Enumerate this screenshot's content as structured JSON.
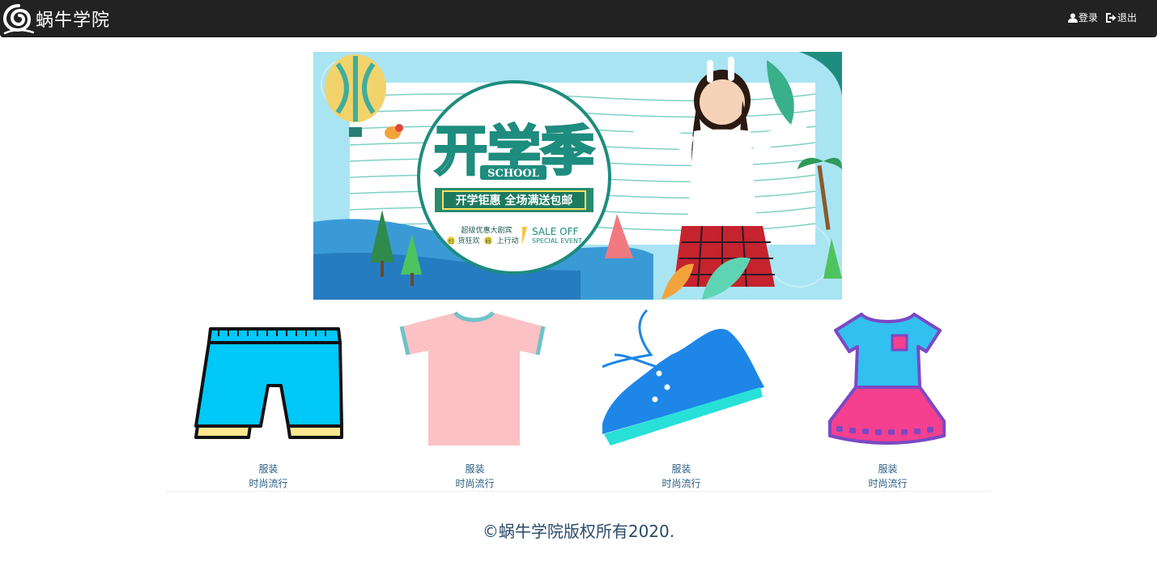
{
  "header": {
    "brand": "蜗牛学院",
    "login_label": "登录",
    "logout_label": "退出"
  },
  "banner": {
    "title": "开学季",
    "school": "SCHOOL",
    "slogan": "开学钜惠 全场满送包邮",
    "promo_line1": "超级优惠大剧宾",
    "promo_line2a": "扫",
    "promo_line2b": "货狂欢",
    "promo_line2c": "码",
    "promo_line2d": "上行动",
    "sale": "SALE OFF",
    "event": "SPECIAL EVENT"
  },
  "products": [
    {
      "name": "服装",
      "desc": "时尚流行",
      "icon": "shorts-icon"
    },
    {
      "name": "服装",
      "desc": "时尚流行",
      "icon": "tshirt-icon"
    },
    {
      "name": "服装",
      "desc": "时尚流行",
      "icon": "sneaker-icon"
    },
    {
      "name": "服装",
      "desc": "时尚流行",
      "icon": "dress-icon"
    }
  ],
  "footer": {
    "copyright": "©蜗牛学院版权所有2020."
  },
  "colors": {
    "navbar": "#222222",
    "link": "#2a5d84",
    "banner_sky": "#a9e4f3",
    "banner_teal": "#1e8c7e"
  }
}
